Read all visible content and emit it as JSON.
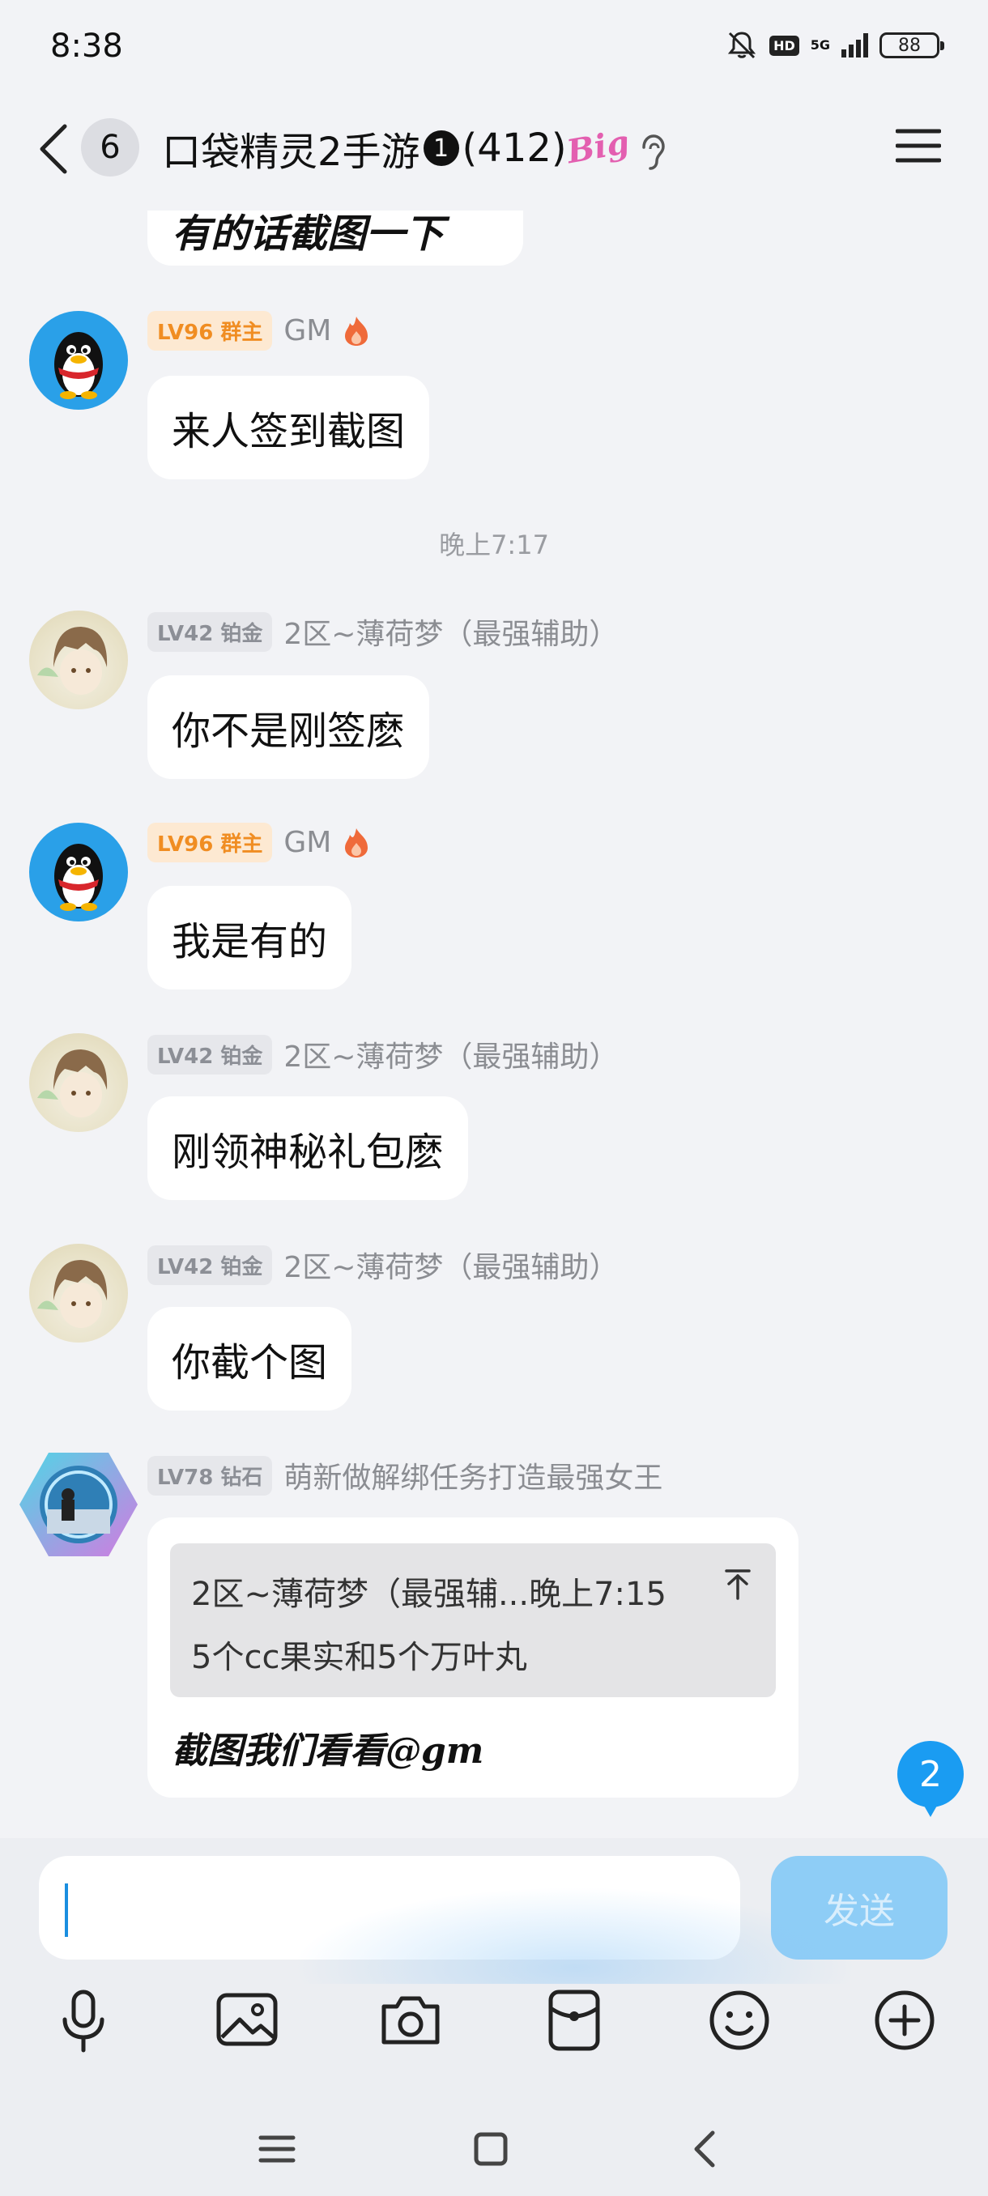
{
  "status_bar": {
    "time": "8:38",
    "network": "5G",
    "hd": "HD",
    "battery": "88"
  },
  "header": {
    "unread_count": "6",
    "group_name": "口袋精灵2手游",
    "group_dot": "1",
    "member_count": "(412)",
    "big_badge": "Big"
  },
  "messages": [
    {
      "text": "有的话截图一下"
    },
    {
      "level": "LV96 群主",
      "nick": "GM",
      "text": "来人签到截图"
    },
    {
      "timestamp": "晚上7:17"
    },
    {
      "level": "LV42 铂金",
      "nick": "2区~薄荷梦（最强辅助）",
      "text": "你不是刚签麽"
    },
    {
      "level": "LV96 群主",
      "nick": "GM",
      "text": "我是有的"
    },
    {
      "level": "LV42 铂金",
      "nick": "2区~薄荷梦（最强辅助）",
      "text": "刚领神秘礼包麽"
    },
    {
      "level": "LV42 铂金",
      "nick": "2区~薄荷梦（最强辅助）",
      "text": "你截个图"
    },
    {
      "level": "LV78 钻石",
      "nick": "萌新做解绑任务打造最强女王",
      "quote_header": "2区~薄荷梦（最强辅...晚上7:15",
      "quote_body": "5个cc果实和5个万叶丸",
      "text": "截图我们看看@gm"
    }
  ],
  "new_messages_badge": "2",
  "input": {
    "placeholder": "",
    "send_label": "发送"
  },
  "toolbar": [
    "microphone-icon",
    "image-icon",
    "camera-icon",
    "red-packet-icon",
    "emoji-icon",
    "plus-icon"
  ],
  "nav": [
    "menu-icon",
    "home-icon",
    "back-icon"
  ],
  "colors": {
    "accent": "#1a9cf2",
    "send_disabled": "#8ecdf6",
    "owner_badge": "#f08d22"
  }
}
